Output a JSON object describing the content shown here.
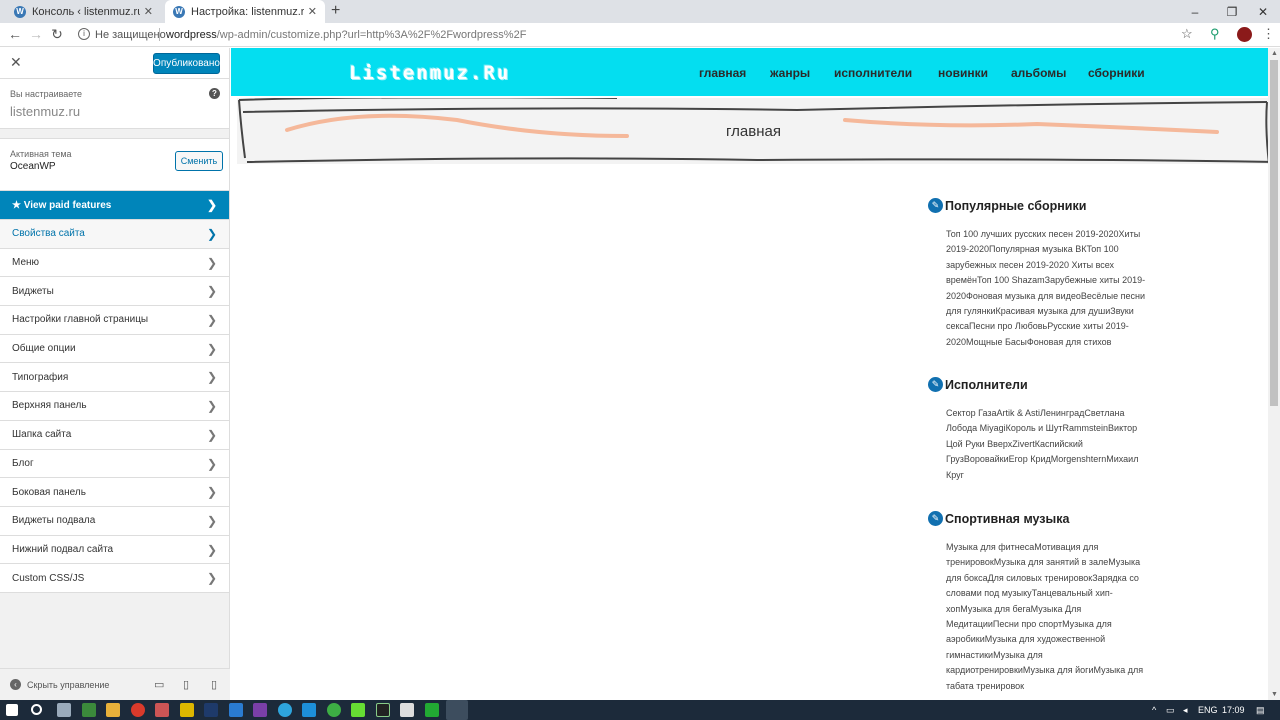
{
  "browser": {
    "tabs": [
      {
        "title": "Консоль ‹ listenmuz.ru — WordPress"
      },
      {
        "title": "Настройка: listenmuz.ru"
      }
    ],
    "address": {
      "security": "Не защищено",
      "url_host": "wordpress",
      "url_path": "/wp-admin/customize.php?url=http%3A%2F%2Fwordpress%2F"
    }
  },
  "customizer": {
    "publish_label": "Опубликовано",
    "customizing_label": "Вы настраиваете",
    "site_name": "listenmuz.ru",
    "active_theme_label": "Активная тема",
    "theme_name": "OceanWP",
    "change_label": "Сменить",
    "paid_label": "★ View paid features",
    "menu": [
      "Свойства сайта",
      "Меню",
      "Виджеты",
      "Настройки главной страницы",
      "Общие опции",
      "Типография",
      "Верхняя панель",
      "Шапка сайта",
      "Блог",
      "Боковая панель",
      "Виджеты подвала",
      "Нижний подвал сайта",
      "Custom CSS/JS"
    ],
    "collapse_label": "Скрыть управление"
  },
  "site": {
    "logo": "Listenmuz.Ru",
    "nav": [
      "главная",
      "жанры",
      "исполнители",
      "новинки",
      "альбомы",
      "сборники"
    ],
    "page_title": "главная",
    "widgets": [
      {
        "title": "Популярные сборники",
        "body": "Топ 100 лучших русских песен 2019-2020Хиты 2019-2020Популярная музыка ВКТоп 100 зарубежных песен 2019-2020 Хиты всех времёнТоп 100 ShazamЗарубежные хиты 2019-2020Фоновая музыка для видеоВесёлые песни для гулянкиКрасивая музыка для душиЗвуки сексаПесни про ЛюбовьРусские хиты 2019-2020Мощные БасыФоновая для стихов"
      },
      {
        "title": "Исполнители",
        "body": "Сектор ГазаArtik & AstiЛенинградСветлана Лобода MiyagiКороль и ШутRammsteinВиктор Цой Руки ВверхZivertКаспийский ГрузВоровайкиЕгор КридMorgenshternМихаил Круг"
      },
      {
        "title": "Спортивная музыка",
        "body": "Музыка для фитнесаМотивация для тренировокМузыка для занятий в залеМузыка для боксаДля силовых тренировокЗарядка со словами под музыкуТанцевальный хип-хопМузыка для бегаМузыка Для МедитацииПесни про спортМузыка для аэробикиМузыка для художественной гимнастикиМузыка для кардиотренировкиМузыка для йогиМузыка для табата тренировок"
      }
    ]
  },
  "taskbar": {
    "lang": "ENG",
    "time": "17:09"
  },
  "colors": {
    "header_bg": "#04def0",
    "wp_blue": "#0085ba",
    "widget_icon": "#1170b0"
  }
}
